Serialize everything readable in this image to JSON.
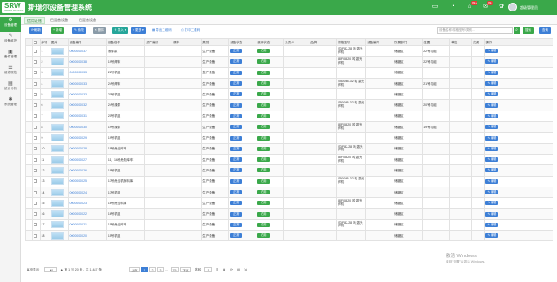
{
  "app": {
    "title": "斯瑞尔设备管理系统",
    "logo_text": "SRW",
    "logo_sub": "SIRRIER MACHINE"
  },
  "header": {
    "badges": {
      "notice": "",
      "alerts": "99+",
      "messages": "99+"
    },
    "username": "超级管理员"
  },
  "sidebar": {
    "items": [
      {
        "label": "设备管理",
        "icon": "gear-icon"
      },
      {
        "label": "设备维护",
        "icon": "wrench-icon"
      },
      {
        "label": "备件管理",
        "icon": "box-icon"
      },
      {
        "label": "维修规范",
        "icon": "book-icon"
      },
      {
        "label": "统计分析",
        "icon": "chart-icon"
      },
      {
        "label": "系统管理",
        "icon": "settings-icon"
      }
    ]
  },
  "tabs": [
    "信用证账",
    "巴是普设备",
    "巴是普设备"
  ],
  "toolbar": {
    "buttons": [
      "刷新",
      "新增",
      "修改",
      "删除",
      "导入",
      "更多"
    ],
    "links": [
      "导出二维码",
      "打印二维码"
    ],
    "search_placeholder": "设备名称/规格型号/类别...",
    "search_btn": "搜索",
    "query_btn": "查询"
  },
  "columns": [
    "序号",
    "图片",
    "设备编号",
    "设备名称",
    "资产编号",
    "原料",
    "类别",
    "设备状态",
    "使用状态",
    "负责人",
    "品牌",
    "规格型号",
    "设备编号",
    "所属部门",
    "位置",
    "单位",
    "归属",
    "操作"
  ],
  "rows": [
    [
      "1",
      "0000000037",
      "滚传泵",
      "",
      "生产设备",
      "正常",
      "在用",
      "SDF82-28 吨 激光焊机",
      "储罐区",
      "22号机组"
    ],
    [
      "2",
      "0000000038",
      "19号焊床",
      "",
      "生产设备",
      "正常",
      "在用",
      "80F08-20 吨 激光焊机",
      "储罐区",
      "22号机组"
    ],
    [
      "3",
      "0000000033",
      "22号机组",
      "",
      "生产设备",
      "正常",
      "在用",
      "",
      "储罐区",
      ""
    ],
    [
      "4",
      "0000000033",
      "24号焊床",
      "",
      "生产设备",
      "正常",
      "在用",
      "SB0065-32 吨 激光焊机",
      "储罐区",
      "21号机组"
    ],
    [
      "5",
      "0000000033",
      "21号机组",
      "",
      "生产设备",
      "正常",
      "在用",
      "",
      "储罐区",
      ""
    ],
    [
      "6",
      "0000000032",
      "24号澡漆",
      "",
      "生产设备",
      "正常",
      "在用",
      "SB0065-32 吨 激光焊机",
      "储罐区",
      "20号机组"
    ],
    [
      "7",
      "0000000031",
      "20号机组",
      "",
      "生产设备",
      "正常",
      "在用",
      "",
      "储罐区",
      ""
    ],
    [
      "8",
      "0000000030",
      "19号澡漆",
      "",
      "生产设备",
      "正常",
      "在用",
      "80F08-20 吨 激光焊机",
      "储罐区",
      "19号机组"
    ],
    [
      "9",
      "0000000029",
      "19号机组",
      "",
      "生产设备",
      "正常",
      "在用",
      "",
      "储罐区",
      ""
    ],
    [
      "10",
      "0000000028",
      "18号危险库车",
      "",
      "生产设备",
      "正常",
      "在用",
      "SDF82-28 吨 激光焊机",
      "储罐区",
      ""
    ],
    [
      "11",
      "0000000027",
      "11、16号危险库车",
      "",
      "生产设备",
      "正常",
      "在用",
      "80F08-20 吨 激光焊机",
      "储罐区",
      ""
    ],
    [
      "12",
      "0000000026",
      "18号机组",
      "",
      "生产设备",
      "正常",
      "在用",
      "",
      "储罐区",
      ""
    ],
    [
      "13",
      "0000000025",
      "17号危险机械料库",
      "",
      "生产设备",
      "正常",
      "在用",
      "SB0065-32 吨 激光焊机",
      "储罐区",
      ""
    ],
    [
      "14",
      "0000000024",
      "17号机组",
      "",
      "生产设备",
      "正常",
      "在用",
      "",
      "储罐区",
      ""
    ],
    [
      "15",
      "0000000023",
      "16号危险料库",
      "",
      "生产设备",
      "正常",
      "在用",
      "80F08-20 吨 激光焊机",
      "储罐区",
      ""
    ],
    [
      "16",
      "0000000022",
      "16号机组",
      "",
      "生产设备",
      "正常",
      "在用",
      "",
      "储罐区",
      ""
    ],
    [
      "17",
      "0000000021",
      "15号危险库车",
      "",
      "生产设备",
      "正常",
      "在用",
      "SDF82-28 吨 激光焊机",
      "储罐区",
      ""
    ],
    [
      "18",
      "0000000020",
      "15号机组",
      "",
      "生产设备",
      "正常",
      "在用",
      "",
      "储罐区",
      ""
    ]
  ],
  "edit_label": "编辑",
  "pager": {
    "prefix": "每页显示",
    "size": "20",
    "summary": "▲ 第 1 到 20 条，共 1,487 条",
    "prev": "上页",
    "pages": [
      "1",
      "2",
      "3",
      "...",
      "75"
    ],
    "next": "下页",
    "goto": "跳转",
    "page_input": "1"
  },
  "watermark": {
    "line1": "激活 Windows",
    "line2": "转到\"设置\"以激活 Windows。"
  }
}
